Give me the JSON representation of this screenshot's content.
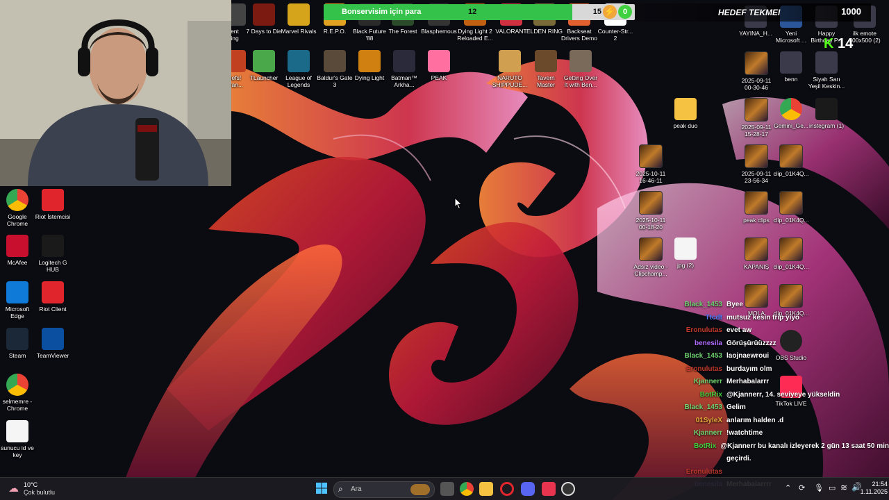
{
  "overlay": {
    "goal_label": "Bonservisim için para",
    "current": "12",
    "target": "15",
    "progress": 0.8,
    "badge_count": "0",
    "goal_title": "HEDEF TEKMEI",
    "goal_value": "1000",
    "k_count": "14"
  },
  "desktop": {
    "top_row": [
      {
        "name": "ent\ning"
      },
      {
        "name": "7 Days to Die"
      },
      {
        "name": "Marvel Rivals"
      },
      {
        "name": "R.E.P.O."
      },
      {
        "name": "Black Future\n'88"
      },
      {
        "name": "The Forest"
      },
      {
        "name": "Blasphemous"
      },
      {
        "name": "Dying Light 2\nReloaded E..."
      },
      {
        "name": "VALORANT"
      },
      {
        "name": "ELDEN RING"
      },
      {
        "name": "Backseat\nDrivers Demo"
      },
      {
        "name": "Counter-Str...\n2"
      }
    ],
    "second_row": [
      {
        "name": "hefs!\naran..."
      },
      {
        "name": "TLauncher"
      },
      {
        "name": "League of\nLegends"
      },
      {
        "name": "Baldur's Gate\n3"
      },
      {
        "name": "Dying Light"
      },
      {
        "name": "Batman™\nArkha..."
      },
      {
        "name": "PEAK"
      },
      {
        "name": "NARUTO\nSHIPPUDE..."
      },
      {
        "name": "Tavern\nMaster"
      },
      {
        "name": "Getting Over\nIt with Ben..."
      }
    ],
    "left_column": [
      {
        "name": "Google\nChrome"
      },
      {
        "name": "Riot İstemcisi"
      },
      {
        "name": "McAfee"
      },
      {
        "name": "Logitech G\nHUB"
      },
      {
        "name": "Microsoft\nEdge"
      },
      {
        "name": "Riot Client"
      },
      {
        "name": "Steam"
      },
      {
        "name": "TeamViewer"
      },
      {
        "name": "selmemre -\nChrome"
      },
      {
        "name": "sunucu id ve\nkey"
      }
    ],
    "right_icons": [
      {
        "name": "YAYINA_H..."
      },
      {
        "name": "Yeni\nMicrosoft ..."
      },
      {
        "name": "Happy\nBirthday P..."
      },
      {
        "name": "ilk emote\n500x500 (2)"
      },
      {
        "name": "2025-09-11\n00-30-46"
      },
      {
        "name": "benn"
      },
      {
        "name": "Siyah Sarı\nYeşil Keskin..."
      },
      {
        "name": "peak duo"
      },
      {
        "name": "2025-09-11\n15-28-17"
      },
      {
        "name": "Gemini_Ge..."
      },
      {
        "name": "instegram (1)"
      },
      {
        "name": "2025-10-11\n16-46-11"
      },
      {
        "name": "2025-09-11\n23-56-34"
      },
      {
        "name": "clip_01K4Q..."
      },
      {
        "name": "2025-10-11\n00-18-20"
      },
      {
        "name": "peak clips"
      },
      {
        "name": "clip_01K4Q..."
      },
      {
        "name": "Adsız video -\nClipchamp..."
      },
      {
        "name": "jpg (2)"
      },
      {
        "name": "KAPANIŞ"
      },
      {
        "name": "clip_01K4Q..."
      },
      {
        "name": "MOLA"
      },
      {
        "name": "clip_01K4Q..."
      },
      {
        "name": "OBS Studio"
      },
      {
        "name": "TikTok LIVE"
      }
    ]
  },
  "chat": [
    {
      "user": "Black_1453",
      "msg": "Byee",
      "color": "#6fd36f"
    },
    {
      "user": "Ttcdt",
      "msg": "mutsuz kesin trip yiyo",
      "color": "#4a7cff"
    },
    {
      "user": "Eronulutas",
      "msg": "evet aw",
      "color": "#c0392b"
    },
    {
      "user": "benesila",
      "msg": "Görüşürüüzzzz",
      "color": "#b06cff"
    },
    {
      "user": "Black_1453",
      "msg": "laojnaewroui",
      "color": "#6fd36f"
    },
    {
      "user": "Eronulutas",
      "msg": "burdayım olm",
      "color": "#c0392b"
    },
    {
      "user": "Kjannerr",
      "msg": "Merhabalarrr",
      "color": "#6fd36f"
    },
    {
      "user": "BotRix",
      "msg": "@Kjannerr, 14. seviyeye yükseldin",
      "color": "#3fd13f"
    },
    {
      "user": "Black_1453",
      "msg": "Gelim",
      "color": "#6fd36f"
    },
    {
      "user": "01SyleX",
      "msg": "anlarım halden .d",
      "color": "#e6a93a"
    },
    {
      "user": "Kjannerr",
      "msg": "!watchtime",
      "color": "#6fd36f"
    },
    {
      "user": "BotRix",
      "msg": "@Kjannerr bu kanalı izleyerek 2 gün 13 saat 50 min",
      "color": "#3fd13f"
    },
    {
      "user": "",
      "msg": "geçirdi.",
      "color": "#ffffff"
    },
    {
      "user": "Eronulutas",
      "msg": "",
      "color": "#c0392b"
    },
    {
      "user": "benesila",
      "msg": "Merhabalarrrr",
      "color": "#b06cff"
    }
  ],
  "taskbar": {
    "weather_temp": "10°C",
    "weather_desc": "Çok bulutlu",
    "search_placeholder": "Ara",
    "time": "21:54",
    "date": "1.11.2025"
  }
}
